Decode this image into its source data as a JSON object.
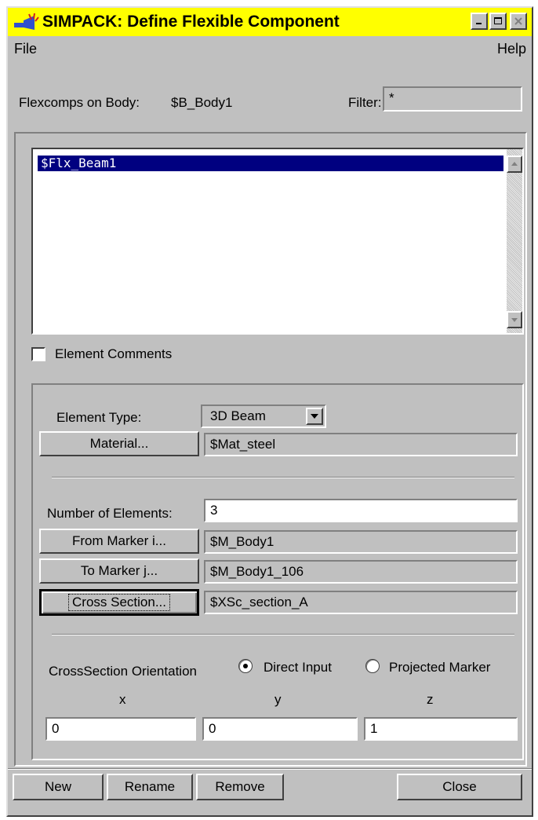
{
  "window": {
    "title": "SIMPACK: Define Flexible Component",
    "controls": {
      "minimize": "minimize-icon",
      "maximize": "maximize-icon",
      "close": "close-icon"
    },
    "title_bg": "#ffff00"
  },
  "menu": {
    "file": "File",
    "help": "Help"
  },
  "header": {
    "flexcomps_label": "Flexcomps on Body:",
    "body_name": "$B_Body1",
    "filter_label": "Filter:",
    "filter_value": "*"
  },
  "list": {
    "items": [
      "$Flx_Beam1"
    ],
    "selection_color": "#000080"
  },
  "element_comments_label": "Element Comments",
  "element": {
    "type_label": "Element Type:",
    "type_value": "3D Beam",
    "material_button": "Material...",
    "material_value": "$Mat_steel",
    "num_elements_label": "Number of Elements:",
    "num_elements_value": "3",
    "from_marker_button": "From Marker i...",
    "from_marker_value": "$M_Body1",
    "to_marker_button": "To Marker j...",
    "to_marker_value": "$M_Body1_106",
    "cross_section_button": "Cross Section...",
    "cross_section_value": "$XSc_section_A"
  },
  "orientation": {
    "label": "CrossSection Orientation",
    "direct_input": "Direct Input",
    "projected_marker": "Projected Marker",
    "selected": "Direct Input",
    "x_label": "x",
    "y_label": "y",
    "z_label": "z",
    "x_value": "0",
    "y_value": "0",
    "z_value": "1"
  },
  "buttons": {
    "new": "New",
    "rename": "Rename",
    "remove": "Remove",
    "close": "Close"
  }
}
